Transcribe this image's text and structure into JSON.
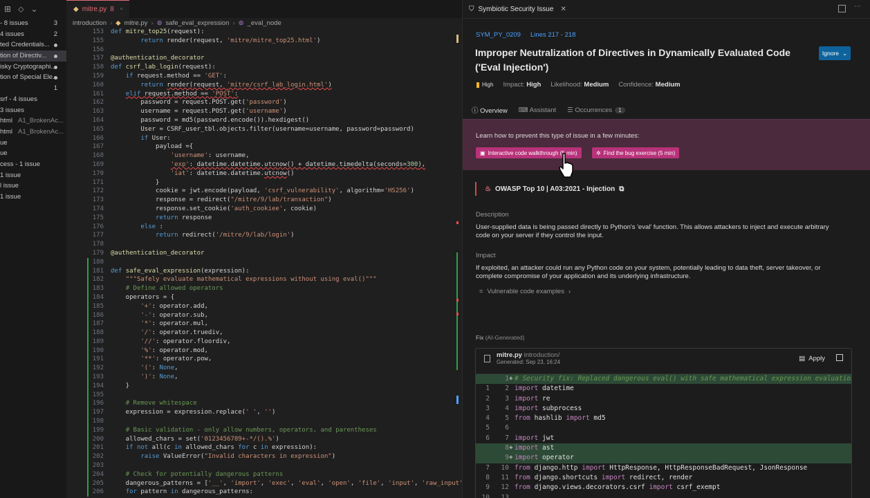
{
  "explorer": {
    "items": [
      {
        "label": "- 8 issues",
        "badge": "3"
      },
      {
        "label": "4 issues",
        "badge": "2"
      },
      {
        "label": "ted Credentials...",
        "badge": "",
        "dot": true
      },
      {
        "label": "tion of Directiv...",
        "badge": "",
        "dot": true,
        "selected": true
      },
      {
        "label": "isky Cryptographi...",
        "badge": "",
        "dot": true
      },
      {
        "label": "tion of Special Ele...",
        "badge": "",
        "dot": true
      },
      {
        "label": "",
        "badge": "1"
      },
      {
        "label": "srf - 4 issues",
        "badge": ""
      },
      {
        "label": "3 issues",
        "badge": ""
      },
      {
        "label": "html",
        "sub": "A1_BrokenAc...",
        "badge": ""
      },
      {
        "label": "html",
        "sub": "A1_BrokenAc...",
        "badge": ""
      },
      {
        "label": "ue",
        "badge": ""
      },
      {
        "label": "ue",
        "badge": ""
      },
      {
        "label": "cess - 1 issue",
        "badge": ""
      },
      {
        "label": "1 issue",
        "badge": ""
      },
      {
        "label": "l issue",
        "badge": ""
      },
      {
        "label": "1 issue",
        "badge": ""
      }
    ]
  },
  "editor": {
    "tab": {
      "label": "mitre.py",
      "count": "8"
    },
    "breadcrumb": [
      "introduction",
      "mitre.py",
      "safe_eval_expression",
      "_eval_node"
    ]
  },
  "panel": {
    "tab_title": "Symbiotic Security Issue",
    "rule_id": "SYM_PY_0209",
    "lines": "Lines 217 - 218",
    "title": "Improper Neutralization of Directives in Dynamically Evaluated Code ('Eval Injection')",
    "ignore_label": "Ignore",
    "severity": "High",
    "impact_label": "Impact:",
    "impact": "High",
    "likelihood_label": "Likelihood:",
    "likelihood": "Medium",
    "confidence_label": "Confidence:",
    "confidence": "Medium",
    "tabs": {
      "overview": "Overview",
      "assistant": "Assistant",
      "occurrences": "Occurrences",
      "occurrences_count": "1"
    },
    "learn_text": "Learn how to prevent this type of issue in a few minutes:",
    "chip1": "Interactive code walkthrough (5 min)",
    "chip2": "Find the bug exercise (5 min)",
    "owasp": "OWASP Top 10 | A03:2021 - Injection",
    "description_heading": "Description",
    "description": "User-supplied data is being passed directly to Python's 'eval' function. This allows attackers to inject and execute arbitrary code on your server if they control the input.",
    "impact_heading": "Impact",
    "impact_text": "If exploited, an attacker could run any Python code on your system, potentially leading to data theft, server takeover, or complete compromise of your application and its underlying infrastructure.",
    "vuln_examples": "Vulnerable code examples",
    "fix_label": "Fix",
    "fix_sub": "(AI-Generated)",
    "fix_file": "mitre.py",
    "fix_dir": "introduction/",
    "fix_generated": "Generated: Sep 23, 16:24",
    "apply_label": "Apply"
  },
  "colors": {
    "accent": "#4ea1ff",
    "chip": "#b8327a",
    "learn_bg": "#4a2a3c",
    "ignore_bg": "#0e639c",
    "diff_add": "#2d4a36"
  }
}
